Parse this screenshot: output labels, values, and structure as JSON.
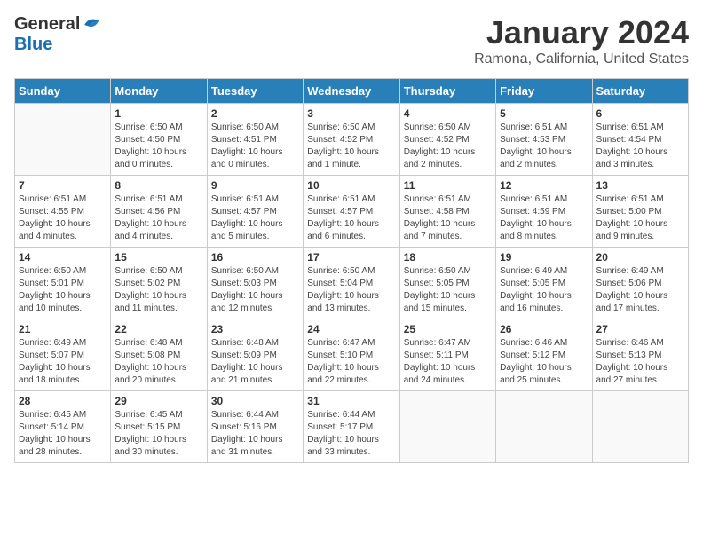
{
  "header": {
    "logo_general": "General",
    "logo_blue": "Blue",
    "month_title": "January 2024",
    "location": "Ramona, California, United States"
  },
  "days_of_week": [
    "Sunday",
    "Monday",
    "Tuesday",
    "Wednesday",
    "Thursday",
    "Friday",
    "Saturday"
  ],
  "weeks": [
    [
      {
        "day": "",
        "info": ""
      },
      {
        "day": "1",
        "info": "Sunrise: 6:50 AM\nSunset: 4:50 PM\nDaylight: 10 hours\nand 0 minutes."
      },
      {
        "day": "2",
        "info": "Sunrise: 6:50 AM\nSunset: 4:51 PM\nDaylight: 10 hours\nand 0 minutes."
      },
      {
        "day": "3",
        "info": "Sunrise: 6:50 AM\nSunset: 4:52 PM\nDaylight: 10 hours\nand 1 minute."
      },
      {
        "day": "4",
        "info": "Sunrise: 6:50 AM\nSunset: 4:52 PM\nDaylight: 10 hours\nand 2 minutes."
      },
      {
        "day": "5",
        "info": "Sunrise: 6:51 AM\nSunset: 4:53 PM\nDaylight: 10 hours\nand 2 minutes."
      },
      {
        "day": "6",
        "info": "Sunrise: 6:51 AM\nSunset: 4:54 PM\nDaylight: 10 hours\nand 3 minutes."
      }
    ],
    [
      {
        "day": "7",
        "info": "Sunrise: 6:51 AM\nSunset: 4:55 PM\nDaylight: 10 hours\nand 4 minutes."
      },
      {
        "day": "8",
        "info": "Sunrise: 6:51 AM\nSunset: 4:56 PM\nDaylight: 10 hours\nand 4 minutes."
      },
      {
        "day": "9",
        "info": "Sunrise: 6:51 AM\nSunset: 4:57 PM\nDaylight: 10 hours\nand 5 minutes."
      },
      {
        "day": "10",
        "info": "Sunrise: 6:51 AM\nSunset: 4:57 PM\nDaylight: 10 hours\nand 6 minutes."
      },
      {
        "day": "11",
        "info": "Sunrise: 6:51 AM\nSunset: 4:58 PM\nDaylight: 10 hours\nand 7 minutes."
      },
      {
        "day": "12",
        "info": "Sunrise: 6:51 AM\nSunset: 4:59 PM\nDaylight: 10 hours\nand 8 minutes."
      },
      {
        "day": "13",
        "info": "Sunrise: 6:51 AM\nSunset: 5:00 PM\nDaylight: 10 hours\nand 9 minutes."
      }
    ],
    [
      {
        "day": "14",
        "info": "Sunrise: 6:50 AM\nSunset: 5:01 PM\nDaylight: 10 hours\nand 10 minutes."
      },
      {
        "day": "15",
        "info": "Sunrise: 6:50 AM\nSunset: 5:02 PM\nDaylight: 10 hours\nand 11 minutes."
      },
      {
        "day": "16",
        "info": "Sunrise: 6:50 AM\nSunset: 5:03 PM\nDaylight: 10 hours\nand 12 minutes."
      },
      {
        "day": "17",
        "info": "Sunrise: 6:50 AM\nSunset: 5:04 PM\nDaylight: 10 hours\nand 13 minutes."
      },
      {
        "day": "18",
        "info": "Sunrise: 6:50 AM\nSunset: 5:05 PM\nDaylight: 10 hours\nand 15 minutes."
      },
      {
        "day": "19",
        "info": "Sunrise: 6:49 AM\nSunset: 5:05 PM\nDaylight: 10 hours\nand 16 minutes."
      },
      {
        "day": "20",
        "info": "Sunrise: 6:49 AM\nSunset: 5:06 PM\nDaylight: 10 hours\nand 17 minutes."
      }
    ],
    [
      {
        "day": "21",
        "info": "Sunrise: 6:49 AM\nSunset: 5:07 PM\nDaylight: 10 hours\nand 18 minutes."
      },
      {
        "day": "22",
        "info": "Sunrise: 6:48 AM\nSunset: 5:08 PM\nDaylight: 10 hours\nand 20 minutes."
      },
      {
        "day": "23",
        "info": "Sunrise: 6:48 AM\nSunset: 5:09 PM\nDaylight: 10 hours\nand 21 minutes."
      },
      {
        "day": "24",
        "info": "Sunrise: 6:47 AM\nSunset: 5:10 PM\nDaylight: 10 hours\nand 22 minutes."
      },
      {
        "day": "25",
        "info": "Sunrise: 6:47 AM\nSunset: 5:11 PM\nDaylight: 10 hours\nand 24 minutes."
      },
      {
        "day": "26",
        "info": "Sunrise: 6:46 AM\nSunset: 5:12 PM\nDaylight: 10 hours\nand 25 minutes."
      },
      {
        "day": "27",
        "info": "Sunrise: 6:46 AM\nSunset: 5:13 PM\nDaylight: 10 hours\nand 27 minutes."
      }
    ],
    [
      {
        "day": "28",
        "info": "Sunrise: 6:45 AM\nSunset: 5:14 PM\nDaylight: 10 hours\nand 28 minutes."
      },
      {
        "day": "29",
        "info": "Sunrise: 6:45 AM\nSunset: 5:15 PM\nDaylight: 10 hours\nand 30 minutes."
      },
      {
        "day": "30",
        "info": "Sunrise: 6:44 AM\nSunset: 5:16 PM\nDaylight: 10 hours\nand 31 minutes."
      },
      {
        "day": "31",
        "info": "Sunrise: 6:44 AM\nSunset: 5:17 PM\nDaylight: 10 hours\nand 33 minutes."
      },
      {
        "day": "",
        "info": ""
      },
      {
        "day": "",
        "info": ""
      },
      {
        "day": "",
        "info": ""
      }
    ]
  ]
}
